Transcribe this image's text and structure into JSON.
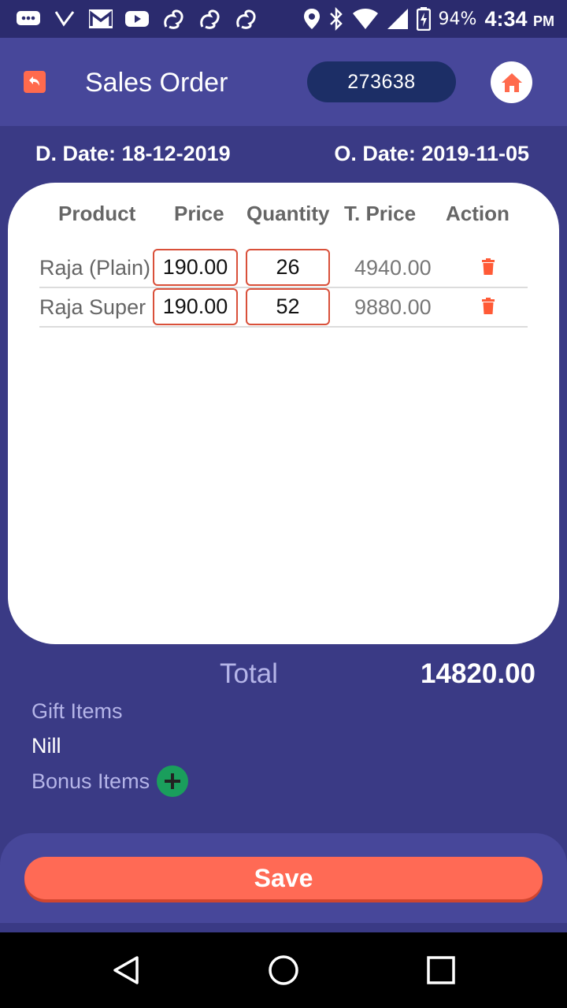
{
  "status_bar": {
    "battery_percent": "94%",
    "time": "4:34",
    "time_suffix": "PM",
    "icons": [
      "messages-icon",
      "missed-call-icon",
      "gmail-icon",
      "youtube-icon",
      "uc-browser-icon",
      "uc-browser-icon",
      "uc-browser-icon",
      "location-icon",
      "bluetooth-icon",
      "wifi-icon",
      "signal-icon",
      "battery-icon"
    ]
  },
  "header": {
    "title": "Sales Order",
    "order_number": "273638",
    "back_icon": "back-arrow-icon",
    "home_icon": "home-icon"
  },
  "dates": {
    "delivery": "D. Date: 18-12-2019",
    "order": "O. Date: 2019-11-05"
  },
  "table": {
    "columns": [
      "Product",
      "Price",
      "Quantity",
      "T. Price",
      "Action"
    ],
    "rows": [
      {
        "product": "Raja (Plain)",
        "price": "190.00",
        "quantity": "26",
        "total_price": "4940.00",
        "action": "delete-icon"
      },
      {
        "product": "Raja Super",
        "price": "190.00",
        "quantity": "52",
        "total_price": "9880.00",
        "action": "delete-icon"
      }
    ]
  },
  "summary": {
    "total_label": "Total",
    "total_value": "14820.00",
    "gift_label": "Gift Items",
    "gift_value": "Nill",
    "bonus_label": "Bonus Items"
  },
  "actions": {
    "save_label": "Save"
  },
  "colors": {
    "background": "#3a3a85",
    "header": "#47479a",
    "accent": "#ff6a55",
    "add_button": "#1a9e5c",
    "pill": "#1c2e66"
  }
}
